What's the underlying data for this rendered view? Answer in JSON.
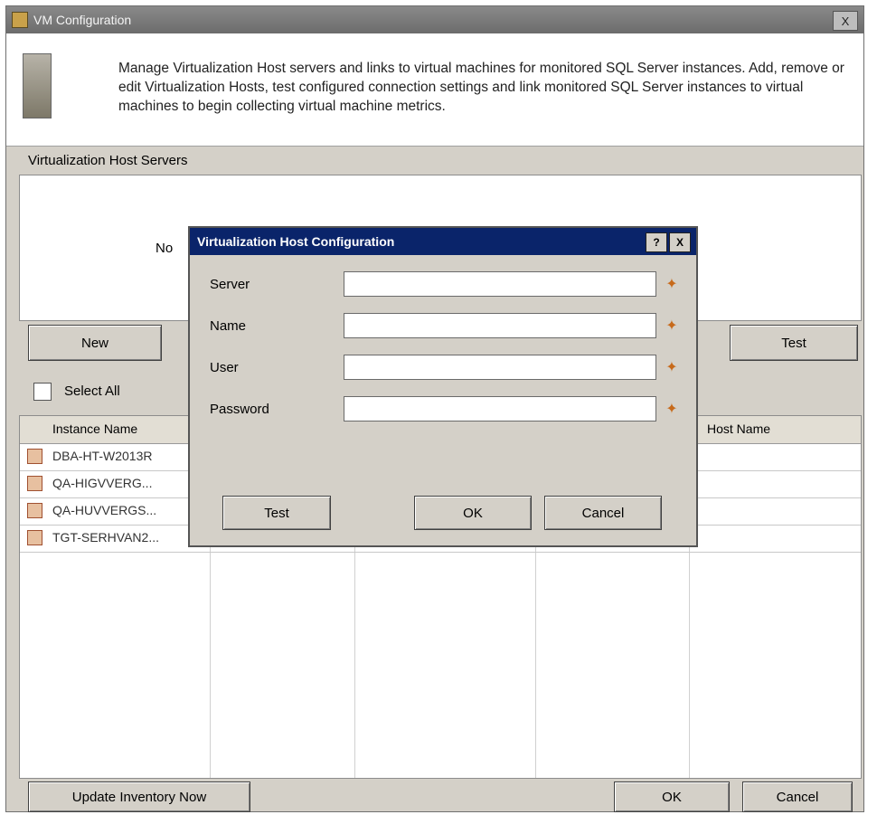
{
  "window": {
    "title": "VM Configuration",
    "close_label": "X"
  },
  "banner": {
    "text": "Manage Virtualization Host servers and links to virtual machines for monitored SQL Server instances. Add, remove or edit Virtualization Hosts, test configured connection settings and link monitored SQL Server instances to virtual machines to begin collecting virtual machine metrics."
  },
  "hosts": {
    "group_label": "Virtualization Host Servers",
    "empty_text": "No"
  },
  "host_buttons": {
    "add": "New",
    "test": "Test"
  },
  "select_all": "Select All",
  "grid": {
    "columns": [
      "Instance Name",
      "",
      "",
      "",
      "Host Name"
    ],
    "rows": [
      {
        "name": "DBA-HT-W2013R"
      },
      {
        "name": "QA-HIGVVERG..."
      },
      {
        "name": "QA-HUVVERGS..."
      },
      {
        "name": "TGT-SERHVAN2..."
      }
    ]
  },
  "dialog": {
    "title": "Virtualization Host Configuration",
    "min_label": "?",
    "close_label": "X",
    "fields": [
      {
        "label": "Server",
        "value": ""
      },
      {
        "label": "Name",
        "value": ""
      },
      {
        "label": "User",
        "value": ""
      },
      {
        "label": "Password",
        "value": ""
      }
    ],
    "buttons": {
      "test": "Test",
      "ok": "OK",
      "cancel": "Cancel"
    }
  },
  "bottom": {
    "update_label": "Update Inventory Now",
    "ok_label": "OK",
    "cancel_label": "Cancel"
  }
}
